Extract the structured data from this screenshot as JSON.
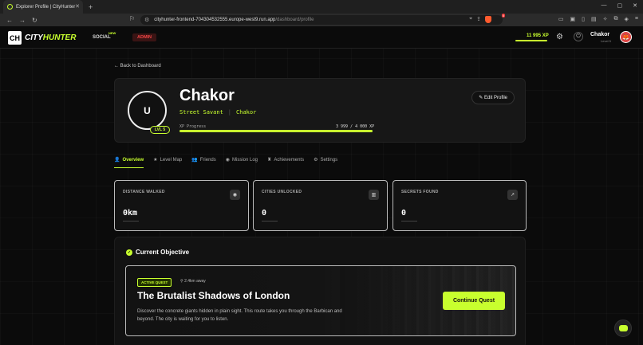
{
  "browser": {
    "tab_title": "Explorer Profile | CityHunter",
    "tab_close": "✕",
    "new_tab": "+",
    "url_host": "cityhunter-frontend-704304532555.europe-west9.run.app",
    "url_path": "/dashboard/profile",
    "ext_badge_count": "5",
    "window_controls": [
      "—",
      "▢",
      "✕"
    ]
  },
  "topnav": {
    "logo_mark": "CH",
    "logo_city": "CITY",
    "logo_hunter": "HUNTER",
    "social": "SOCIAL",
    "social_badge": "NEW",
    "admin": "ADMIN",
    "xp": "11 995 XP",
    "user_name": "Chakor",
    "user_level": "Level 5"
  },
  "back_link": "← Back to Dashboard",
  "profile": {
    "initial": "U",
    "level": "LVL 5",
    "name": "Chakor",
    "rank": "Street Savant",
    "separator": "|",
    "handle": "Chakor",
    "xp_label": "XP Progress",
    "xp_value": "3 999 / 4 000 XP",
    "xp_fraction": 0.9998,
    "edit_button": "Edit Profile"
  },
  "tabs": [
    {
      "icon": "👤",
      "label": "Overview",
      "active": true
    },
    {
      "icon": "★",
      "label": "Level Map"
    },
    {
      "icon": "👥",
      "label": "Friends"
    },
    {
      "icon": "◉",
      "label": "Mission Log"
    },
    {
      "icon": "♜",
      "label": "Achievements"
    },
    {
      "icon": "⚙",
      "label": "Settings"
    }
  ],
  "stats": [
    {
      "label": "DISTANCE WALKED",
      "value": "0km",
      "icon": "compass-icon"
    },
    {
      "label": "CITIES UNLOCKED",
      "value": "0",
      "icon": "city-icon"
    },
    {
      "label": "SECRETS FOUND",
      "value": "0",
      "icon": "trend-up-icon"
    }
  ],
  "objective": {
    "title": "Current Objective",
    "badge": "ACTIVE QUEST",
    "distance": "2.4km away",
    "quest_name": "The Brutalist Shadows of London",
    "description": "Discover the concrete giants hidden in plain sight. This route takes you through the Barbican and beyond. The city is waiting for you to listen.",
    "button": "Continue Quest"
  },
  "colors": {
    "accent": "#c8ff2e",
    "admin": "#e44444"
  }
}
